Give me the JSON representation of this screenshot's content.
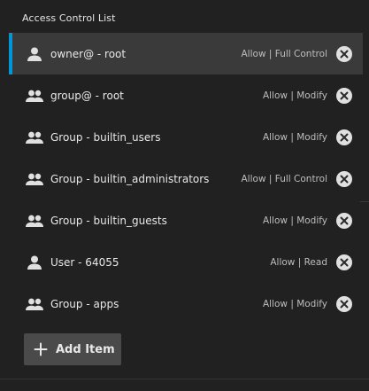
{
  "panel": {
    "title": "Access Control List"
  },
  "items": [
    {
      "who": "owner@ - root",
      "icon": "user-icon",
      "permission": "Allow | Full Control",
      "selected": true
    },
    {
      "who": "group@ - root",
      "icon": "group-icon",
      "permission": "Allow | Modify",
      "selected": false
    },
    {
      "who": "Group - builtin_users",
      "icon": "group-icon",
      "permission": "Allow | Modify",
      "selected": false
    },
    {
      "who": "Group - builtin_administrators",
      "icon": "group-icon",
      "permission": "Allow | Full Control",
      "selected": false
    },
    {
      "who": "Group - builtin_guests",
      "icon": "group-icon",
      "permission": "Allow | Modify",
      "selected": false
    },
    {
      "who": "User - 64055",
      "icon": "user-icon",
      "permission": "Allow | Read",
      "selected": false
    },
    {
      "who": "Group - apps",
      "icon": "group-icon",
      "permission": "Allow | Modify",
      "selected": false
    }
  ],
  "add_button": {
    "label": "Add Item",
    "icon": "plus-icon"
  },
  "colors": {
    "accent": "#0095d5",
    "background": "#212121",
    "selected_row": "#3a3a3a"
  }
}
